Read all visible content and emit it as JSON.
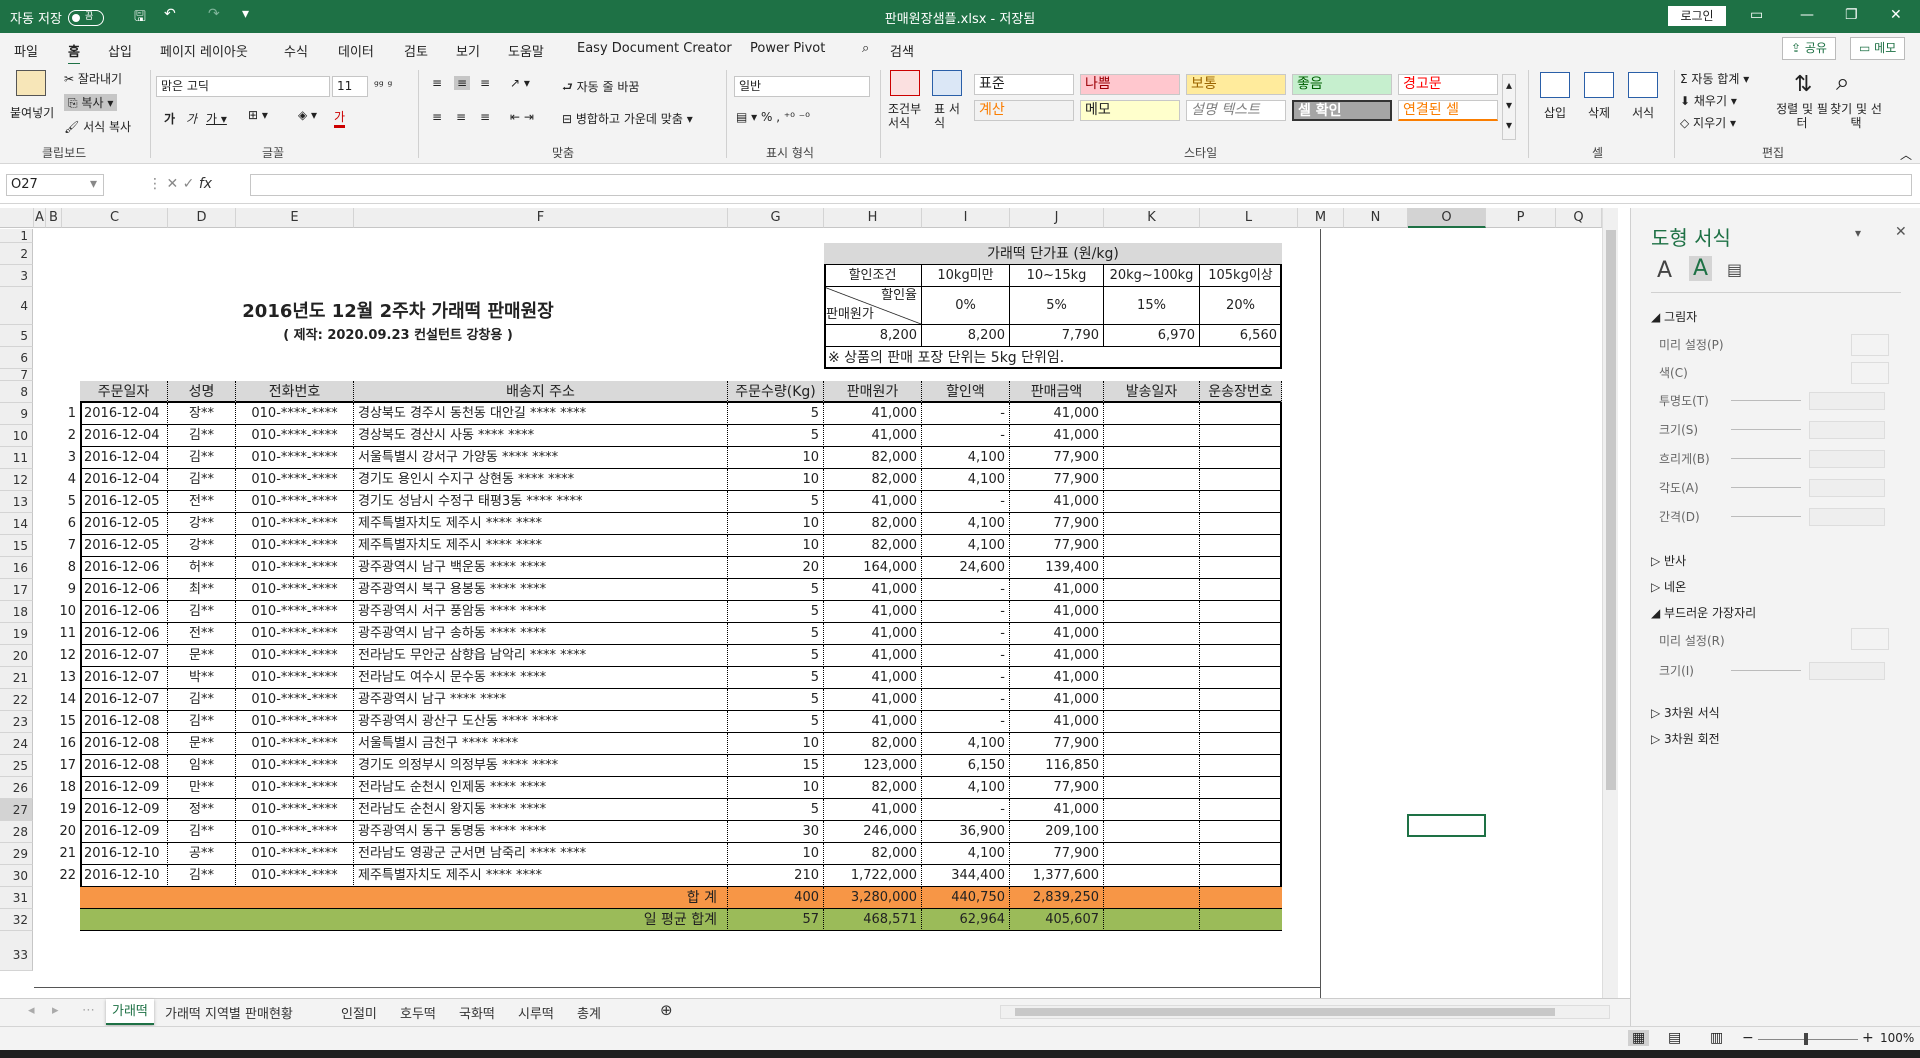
{
  "titlebar": {
    "autosave": "자동 저장",
    "toggle": "끔",
    "title": "판매원장샘플.xlsx - 저장됨",
    "login": "로그인"
  },
  "menu": [
    "파일",
    "홈",
    "삽입",
    "페이지 레이아웃",
    "수식",
    "데이터",
    "검토",
    "보기",
    "도움말",
    "Easy Document Creator",
    "Power Pivot",
    "검색"
  ],
  "share": "공유",
  "memo": "메모",
  "ribbon": {
    "paste": "붙여넣기",
    "cut": "잘라내기",
    "copy": "복사",
    "format_painter": "서식 복사",
    "clipboard": "클립보드",
    "font_name": "맑은 고딕",
    "font_size": "11",
    "font_group": "글꼴",
    "wrap": "자동 줄 바꿈",
    "merge": "병합하고 가운데 맞춤",
    "align_group": "맞춤",
    "number_format": "일반",
    "number_group": "표시 형식",
    "cond_format": "조건부 서식",
    "table_format": "표 서식",
    "styles": [
      [
        "표준",
        "#ffffff",
        "#222222"
      ],
      [
        "나쁨",
        "#ffc7ce",
        "#9c0006"
      ],
      [
        "보통",
        "#ffeb9c",
        "#9c6500"
      ],
      [
        "좋음",
        "#c6efce",
        "#006100"
      ],
      [
        "경고문",
        "#ffffff",
        "#ff0000"
      ],
      [
        "계산",
        "#f2f2f2",
        "#fa7d00"
      ],
      [
        "메모",
        "#ffffcc",
        "#222222"
      ],
      [
        "설명 텍스트",
        "#ffffff",
        "#7f7f7f"
      ],
      [
        "셀 확인",
        "#a5a5a5",
        "#ffffff"
      ],
      [
        "연결된 셀",
        "#ffffff",
        "#fa7d00"
      ]
    ],
    "style_group": "스타일",
    "insert": "삽입",
    "delete": "삭제",
    "format": "서식",
    "cells_group": "셀",
    "autosum": "자동 합계",
    "fill": "채우기",
    "clear": "지우기",
    "sort_filter": "정렬 및 필터",
    "find_select": "찾기 및 선택",
    "edit_group": "편집"
  },
  "namebox": "O27",
  "columns": [
    "A",
    "B",
    "C",
    "D",
    "E",
    "F",
    "G",
    "H",
    "I",
    "J",
    "K",
    "L",
    "M",
    "N",
    "O",
    "P",
    "Q"
  ],
  "rows": [
    "1",
    "2",
    "3",
    "4",
    "5",
    "6",
    "7",
    "8",
    "9",
    "10",
    "11",
    "12",
    "13",
    "14",
    "15",
    "16",
    "17",
    "18",
    "19",
    "20",
    "21",
    "22",
    "23",
    "24",
    "25",
    "26",
    "27",
    "28",
    "29",
    "30",
    "31",
    "32",
    "33"
  ],
  "sheet": {
    "title": "2016년도 12월 2주차 가래떡 판매원장",
    "subtitle": "( 제작: 2020.09.23 컨설턴트 강창용 )",
    "price_table": {
      "title": "가래떡 단가표 (원/kg)",
      "cond": "할인조건",
      "tiers": [
        "10kg미만",
        "10~15kg",
        "20kg~100kg",
        "105kg이상"
      ],
      "diag_top": "할인율",
      "diag_bottom": "판매원가",
      "rates": [
        "0%",
        "5%",
        "15%",
        "20%"
      ],
      "base": "8,200",
      "prices": [
        "8,200",
        "7,790",
        "6,970",
        "6,560"
      ],
      "note": "※ 상품의 판매 포장 단위는 5kg 단위임."
    },
    "headers": [
      "주문일자",
      "성명",
      "전화번호",
      "배송지 주소",
      "주문수량(Kg)",
      "판매원가",
      "할인액",
      "판매금액",
      "발송일자",
      "운송장번호"
    ],
    "rows": [
      [
        "1",
        "2016-12-04",
        "장**",
        "010-****-****",
        "경상북도 경주시 동천동 대안길 **** ****",
        "5",
        "41,000",
        "-",
        "41,000"
      ],
      [
        "2",
        "2016-12-04",
        "김**",
        "010-****-****",
        "경상북도 경산시 사동 **** ****",
        "5",
        "41,000",
        "-",
        "41,000"
      ],
      [
        "3",
        "2016-12-04",
        "김**",
        "010-****-****",
        "서울특별시 강서구 가양동 **** ****",
        "10",
        "82,000",
        "4,100",
        "77,900"
      ],
      [
        "4",
        "2016-12-04",
        "김**",
        "010-****-****",
        "경기도 용인시 수지구 상현동 **** ****",
        "10",
        "82,000",
        "4,100",
        "77,900"
      ],
      [
        "5",
        "2016-12-05",
        "전**",
        "010-****-****",
        "경기도 성남시 수정구 태평3동 **** ****",
        "5",
        "41,000",
        "-",
        "41,000"
      ],
      [
        "6",
        "2016-12-05",
        "강**",
        "010-****-****",
        "제주특별자치도 제주시 **** ****",
        "10",
        "82,000",
        "4,100",
        "77,900"
      ],
      [
        "7",
        "2016-12-05",
        "강**",
        "010-****-****",
        "제주특별자치도 제주시 **** ****",
        "10",
        "82,000",
        "4,100",
        "77,900"
      ],
      [
        "8",
        "2016-12-06",
        "허**",
        "010-****-****",
        "광주광역시 남구 백운동 **** ****",
        "20",
        "164,000",
        "24,600",
        "139,400"
      ],
      [
        "9",
        "2016-12-06",
        "최**",
        "010-****-****",
        "광주광역시 북구 용봉동 **** ****",
        "5",
        "41,000",
        "-",
        "41,000"
      ],
      [
        "10",
        "2016-12-06",
        "김**",
        "010-****-****",
        "광주광역시 서구 풍암동 **** ****",
        "5",
        "41,000",
        "-",
        "41,000"
      ],
      [
        "11",
        "2016-12-06",
        "전**",
        "010-****-****",
        "광주광역시 남구 송하동 **** ****",
        "5",
        "41,000",
        "-",
        "41,000"
      ],
      [
        "12",
        "2016-12-07",
        "문**",
        "010-****-****",
        "전라남도 무안군 삼향읍 남악리 **** ****",
        "5",
        "41,000",
        "-",
        "41,000"
      ],
      [
        "13",
        "2016-12-07",
        "박**",
        "010-****-****",
        "전라남도 여수시 문수동 **** ****",
        "5",
        "41,000",
        "-",
        "41,000"
      ],
      [
        "14",
        "2016-12-07",
        "김**",
        "010-****-****",
        "광주광역시 남구 **** ****",
        "5",
        "41,000",
        "-",
        "41,000"
      ],
      [
        "15",
        "2016-12-08",
        "김**",
        "010-****-****",
        "광주광역시 광산구 도산동 **** ****",
        "5",
        "41,000",
        "-",
        "41,000"
      ],
      [
        "16",
        "2016-12-08",
        "문**",
        "010-****-****",
        "서울특별시 금천구 **** ****",
        "10",
        "82,000",
        "4,100",
        "77,900"
      ],
      [
        "17",
        "2016-12-08",
        "임**",
        "010-****-****",
        "경기도 의정부시 의정부동 **** ****",
        "15",
        "123,000",
        "6,150",
        "116,850"
      ],
      [
        "18",
        "2016-12-09",
        "만**",
        "010-****-****",
        "전라남도 순천시 인제동 **** ****",
        "10",
        "82,000",
        "4,100",
        "77,900"
      ],
      [
        "19",
        "2016-12-09",
        "정**",
        "010-****-****",
        "전라남도 순천시 왕지동 **** ****",
        "5",
        "41,000",
        "-",
        "41,000"
      ],
      [
        "20",
        "2016-12-09",
        "김**",
        "010-****-****",
        "광주광역시 동구 동명동 **** ****",
        "30",
        "246,000",
        "36,900",
        "209,100"
      ],
      [
        "21",
        "2016-12-10",
        "공**",
        "010-****-****",
        "전라남도 영광군 군서면 남죽리 **** ****",
        "10",
        "82,000",
        "4,100",
        "77,900"
      ],
      [
        "22",
        "2016-12-10",
        "김**",
        "010-****-****",
        "제주특별자치도 제주시 **** ****",
        "210",
        "1,722,000",
        "344,400",
        "1,377,600"
      ]
    ],
    "total": {
      "label": "합    계",
      "qty": "400",
      "cost": "3,280,000",
      "disc": "440,750",
      "amount": "2,839,250"
    },
    "avg": {
      "label": "일 평균 합계",
      "qty": "57",
      "cost": "468,571",
      "disc": "62,964",
      "amount": "405,607"
    }
  },
  "pane": {
    "title": "도형 서식",
    "sections": [
      "그림자",
      "미리 설정(P)",
      "색(C)",
      "투명도(T)",
      "크기(S)",
      "흐리게(B)",
      "각도(A)",
      "간격(D)",
      "반사",
      "네온",
      "부드러운 가장자리",
      "미리 설정(R)",
      "크기(I)",
      "3차원 서식",
      "3차원 회전"
    ]
  },
  "tabs": [
    "가래떡",
    "가래떡 지역별 판매현황",
    "인절미",
    "호두떡",
    "국화떡",
    "시루떡",
    "총계"
  ],
  "zoom": "100%"
}
